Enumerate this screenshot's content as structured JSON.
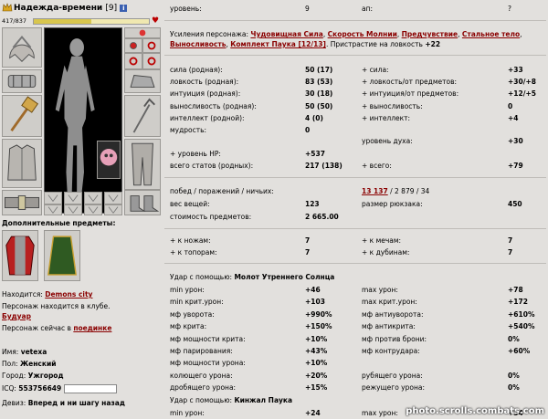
{
  "header": {
    "nick": "Надежда-времени",
    "level": "[9]",
    "info": "i"
  },
  "hp": {
    "text": "417/837",
    "fraction": 0.5
  },
  "extra_items_title": "Дополнительные предметы:",
  "location": {
    "label": "Находится:",
    "value": "Demons city"
  },
  "club": {
    "text": "Персонаж находится в клубе."
  },
  "boudoir": "Будуар",
  "duel": {
    "text": "Персонаж сейчас в",
    "link": "поединке"
  },
  "profile": {
    "name_label": "Имя:",
    "name_value": "vetexa",
    "gender_label": "Пол:",
    "gender_value": "Женский",
    "city_label": "Город:",
    "city_value": "Ужгород",
    "icq_label": "ICQ:",
    "icq_value": "553756649",
    "motto_label": "Девиз:",
    "motto_value": "Вперед и ни шагу назад"
  },
  "top": {
    "level_label": "уровень:",
    "level_value": "9",
    "ap_label": "ап:",
    "ap_value": "?"
  },
  "boosts": {
    "prefix": "Усиления персонажа:",
    "items": [
      "Чудовищная Сила",
      "Скорость Молнии",
      "Предчувствие",
      "Стальное тело",
      "Выносливость",
      "Комплект Паука [12/13]"
    ],
    "suffix": "Пристрастие на ловкость",
    "suffix_value": "+22"
  },
  "stats": [
    {
      "l": "сила (родная):",
      "v": "50 (17)",
      "l2": "+ сила:",
      "v2": "+33"
    },
    {
      "l": "ловкость (родная):",
      "v": "83 (53)",
      "l2": "+ ловкость/от предметов:",
      "v2": "+30/+8"
    },
    {
      "l": "интуиция (родная):",
      "v": "30 (18)",
      "l2": "+ интуиция/от предметов:",
      "v2": "+12/+5"
    },
    {
      "l": "выносливость (родная):",
      "v": "50 (50)",
      "l2": "+ выносливость:",
      "v2": "0"
    },
    {
      "l": "интеллект (родной):",
      "v": "4 (0)",
      "l2": "+ интеллект:",
      "v2": "+4"
    },
    {
      "l": "мудрость:",
      "v": "0",
      "l2": "",
      "v2": ""
    }
  ],
  "spirit": {
    "label": "уровень духа:",
    "value": "+30"
  },
  "hp_plus": {
    "label": "+ уровень HP:",
    "value": "+537"
  },
  "totals": {
    "label": "всего статов (родных):",
    "value": "217 (138)",
    "label2": "+ всего:",
    "value2": "+79"
  },
  "wins": {
    "label": "побед / поражений / ничьих:",
    "wins": "13 137",
    "rest": "/ 2 879 / 34"
  },
  "weight": {
    "label": "вес вещей:",
    "value": "123",
    "label2": "размер рюкзака:",
    "value2": "450"
  },
  "cost": {
    "label": "стоимость предметов:",
    "value": "2 665.00"
  },
  "skills": [
    {
      "l": "+ к ножам:",
      "v": "7",
      "l2": "+ к мечам:",
      "v2": "7"
    },
    {
      "l": "+ к топорам:",
      "v": "7",
      "l2": "+ к дубинам:",
      "v2": "7"
    }
  ],
  "weapon1": {
    "title_label": "Удар с помощью:",
    "title_value": "Молот Утреннего Солнца",
    "rows": [
      {
        "l": "min урон:",
        "v": "+46",
        "l2": "max урон:",
        "v2": "+78"
      },
      {
        "l": "min крит.урон:",
        "v": "+103",
        "l2": "max крит.урон:",
        "v2": "+172"
      },
      {
        "l": "мф уворота:",
        "v": "+990%",
        "l2": "мф антиуворота:",
        "v2": "+610%"
      },
      {
        "l": "мф крита:",
        "v": "+150%",
        "l2": "мф антикрита:",
        "v2": "+540%"
      },
      {
        "l": "мф мощности крита:",
        "v": "+10%",
        "l2": "мф против брони:",
        "v2": "0%"
      },
      {
        "l": "мф парирования:",
        "v": "+43%",
        "l2": "мф контрудара:",
        "v2": "+60%"
      },
      {
        "l": "мф мощности урона:",
        "v": "+10%",
        "l2": "",
        "v2": ""
      },
      {
        "l": "колющего урона:",
        "v": "+20%",
        "l2": "рубящего урона:",
        "v2": "0%"
      },
      {
        "l": "дробящего урона:",
        "v": "+15%",
        "l2": "режущего урона:",
        "v2": "0%"
      }
    ]
  },
  "weapon2": {
    "title_label": "Удар с помощью:",
    "title_value": "Кинжал Паука",
    "rows": [
      {
        "l": "min урон:",
        "v": "+24",
        "l2": "max урон:",
        "v2": "+34"
      }
    ]
  },
  "watermark": "photo.scrolls.combats.com"
}
